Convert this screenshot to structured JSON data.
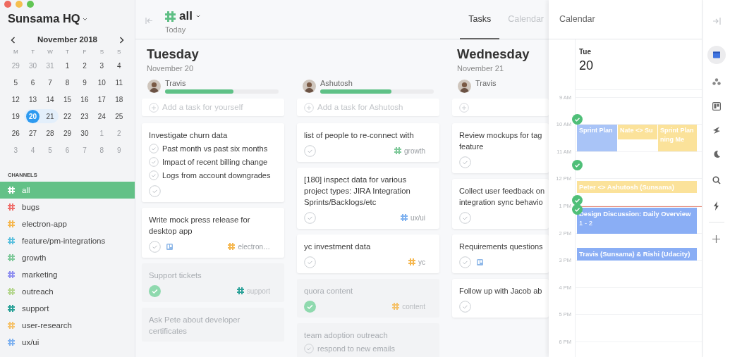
{
  "sidebar": {
    "workspace": "Sunsama HQ",
    "month": "November 2018",
    "weekdays": [
      "M",
      "T",
      "W",
      "T",
      "F",
      "S",
      "S"
    ],
    "days": [
      {
        "label": "29",
        "muted": true,
        "selected": false,
        "in_range": false
      },
      {
        "label": "30",
        "muted": true,
        "selected": false,
        "in_range": false
      },
      {
        "label": "31",
        "muted": true,
        "selected": false,
        "in_range": false
      },
      {
        "label": "1",
        "muted": false,
        "selected": false,
        "in_range": false
      },
      {
        "label": "2",
        "muted": false,
        "selected": false,
        "in_range": false
      },
      {
        "label": "3",
        "muted": false,
        "selected": false,
        "in_range": false
      },
      {
        "label": "4",
        "muted": false,
        "selected": false,
        "in_range": false
      },
      {
        "label": "5",
        "muted": false,
        "selected": false,
        "in_range": false
      },
      {
        "label": "6",
        "muted": false,
        "selected": false,
        "in_range": false
      },
      {
        "label": "7",
        "muted": false,
        "selected": false,
        "in_range": false
      },
      {
        "label": "8",
        "muted": false,
        "selected": false,
        "in_range": false
      },
      {
        "label": "9",
        "muted": false,
        "selected": false,
        "in_range": false
      },
      {
        "label": "10",
        "muted": false,
        "selected": false,
        "in_range": false
      },
      {
        "label": "11",
        "muted": false,
        "selected": false,
        "in_range": false
      },
      {
        "label": "12",
        "muted": false,
        "selected": false,
        "in_range": false
      },
      {
        "label": "13",
        "muted": false,
        "selected": false,
        "in_range": false
      },
      {
        "label": "14",
        "muted": false,
        "selected": false,
        "in_range": false
      },
      {
        "label": "15",
        "muted": false,
        "selected": false,
        "in_range": false
      },
      {
        "label": "16",
        "muted": false,
        "selected": false,
        "in_range": false
      },
      {
        "label": "17",
        "muted": false,
        "selected": false,
        "in_range": false
      },
      {
        "label": "18",
        "muted": false,
        "selected": false,
        "in_range": false
      },
      {
        "label": "19",
        "muted": false,
        "selected": false,
        "in_range": false
      },
      {
        "label": "20",
        "muted": false,
        "selected": true,
        "in_range": true
      },
      {
        "label": "21",
        "muted": false,
        "selected": false,
        "in_range": true
      },
      {
        "label": "22",
        "muted": false,
        "selected": false,
        "in_range": false
      },
      {
        "label": "23",
        "muted": false,
        "selected": false,
        "in_range": false
      },
      {
        "label": "24",
        "muted": false,
        "selected": false,
        "in_range": false
      },
      {
        "label": "25",
        "muted": false,
        "selected": false,
        "in_range": false
      },
      {
        "label": "26",
        "muted": false,
        "selected": false,
        "in_range": false
      },
      {
        "label": "27",
        "muted": false,
        "selected": false,
        "in_range": false
      },
      {
        "label": "28",
        "muted": false,
        "selected": false,
        "in_range": false
      },
      {
        "label": "29",
        "muted": false,
        "selected": false,
        "in_range": false
      },
      {
        "label": "30",
        "muted": false,
        "selected": false,
        "in_range": false
      },
      {
        "label": "1",
        "muted": true,
        "selected": false,
        "in_range": false
      },
      {
        "label": "2",
        "muted": true,
        "selected": false,
        "in_range": false
      },
      {
        "label": "3",
        "muted": true,
        "selected": false,
        "in_range": false
      },
      {
        "label": "4",
        "muted": true,
        "selected": false,
        "in_range": false
      },
      {
        "label": "5",
        "muted": true,
        "selected": false,
        "in_range": false
      },
      {
        "label": "6",
        "muted": true,
        "selected": false,
        "in_range": false
      },
      {
        "label": "7",
        "muted": true,
        "selected": false,
        "in_range": false
      },
      {
        "label": "8",
        "muted": true,
        "selected": false,
        "in_range": false
      },
      {
        "label": "9",
        "muted": true,
        "selected": false,
        "in_range": false
      }
    ],
    "channels_heading": "CHANNELS",
    "channels": [
      {
        "label": "all",
        "selected": true
      },
      {
        "label": "bugs",
        "color": "#ef6f6c",
        "selected": false
      },
      {
        "label": "electron-app",
        "color": "#f5b74f",
        "selected": false
      },
      {
        "label": "feature/pm-integrations",
        "color": "#5bc0de",
        "selected": false
      },
      {
        "label": "growth",
        "color": "#7fc99a",
        "selected": false
      },
      {
        "label": "marketing",
        "color": "#8f8ff0",
        "selected": false
      },
      {
        "label": "outreach",
        "color": "#b5d68f",
        "selected": false
      },
      {
        "label": "support",
        "color": "#2aa198",
        "selected": false
      },
      {
        "label": "user-research",
        "color": "#f5c26b",
        "selected": false
      },
      {
        "label": "ux/ui",
        "color": "#7fb2f0",
        "selected": false
      }
    ]
  },
  "header": {
    "channel": "all",
    "subtitle": "Today",
    "tabs": [
      {
        "label": "Tasks",
        "selected": true
      },
      {
        "label": "Calendar",
        "selected": false
      }
    ]
  },
  "days": [
    {
      "weekday": "Tuesday",
      "date": "November 20",
      "people": [
        {
          "name": "Travis",
          "level": 0.6,
          "placeholder": "Add a task for yourself",
          "cards": [
            {
              "title": "Investigate churn data",
              "done": false,
              "subtasks": [
                "Past month vs past six months",
                "Impact of recent billing change",
                "Logs from account downgrades"
              ]
            },
            {
              "title": "Write mock press release for desktop app",
              "done": false,
              "attachment": true,
              "tag": {
                "label": "electron…",
                "color": "#f5b74f"
              }
            },
            {
              "title": "Support tickets",
              "done": true,
              "tag": {
                "label": "support",
                "color": "#2aa198"
              }
            },
            {
              "title": "Ask Pete about developer certificates",
              "done": false,
              "faded": true
            }
          ]
        },
        {
          "name": "Ashutosh",
          "level": 0.63,
          "placeholder": "Add a task for Ashutosh",
          "cards": [
            {
              "title": "list of people to re-connect with",
              "done": false,
              "tag": {
                "label": "growth",
                "color": "#7fc99a"
              }
            },
            {
              "title": "[180] inspect data for various project types: JIRA Integration Sprints/Backlogs/etc",
              "done": false,
              "tag": {
                "label": "ux/ui",
                "color": "#7fb2f0"
              }
            },
            {
              "title": "yc investment data",
              "done": false,
              "tag": {
                "label": "yc",
                "color": "#f5b74f"
              }
            },
            {
              "title": "quora content",
              "done": true,
              "tag": {
                "label": "content",
                "color": "#f5c26b"
              }
            },
            {
              "title": "team adoption outreach",
              "done": false,
              "faded": true,
              "subtasks": [
                "respond to new emails"
              ]
            }
          ]
        }
      ]
    },
    {
      "weekday": "Wednesday",
      "date": "November 21",
      "people": [
        {
          "name": "Travis",
          "cards": [
            {
              "title": "Review mockups for tag\nfeature",
              "done": false
            },
            {
              "title": "Collect user feedback on\nintegration sync behavio",
              "done": false
            },
            {
              "title": "Requirements questions",
              "done": false,
              "attachment": true
            },
            {
              "title": "Follow up with Jacob ab",
              "done": false
            }
          ]
        }
      ]
    }
  ],
  "calendar": {
    "title": "Calendar",
    "day_name": "Tue",
    "day_number": "20",
    "hours": [
      "9 AM",
      "10 AM",
      "11 AM",
      "12 PM",
      "1 PM",
      "2 PM",
      "3 PM",
      "4 PM",
      "5 PM",
      "6 PM"
    ],
    "events": [
      {
        "title": "Sprint Plan",
        "color": "#a9c4f7"
      },
      {
        "title": "Nate <> Su",
        "color": "#fbe29a"
      },
      {
        "title": "Sprint Planning Me",
        "color": "#fbe29a"
      },
      {
        "title": "Peter <> Ashutosh (Sunsama)",
        "color": "#fbe29a"
      },
      {
        "title": "Design Discussion: Daily Overview",
        "time": "1 - 2",
        "color": "#8aaef5"
      },
      {
        "title": "Travis (Sunsama) & Rishi (Udacity)",
        "color": "#8aaef5"
      }
    ]
  }
}
